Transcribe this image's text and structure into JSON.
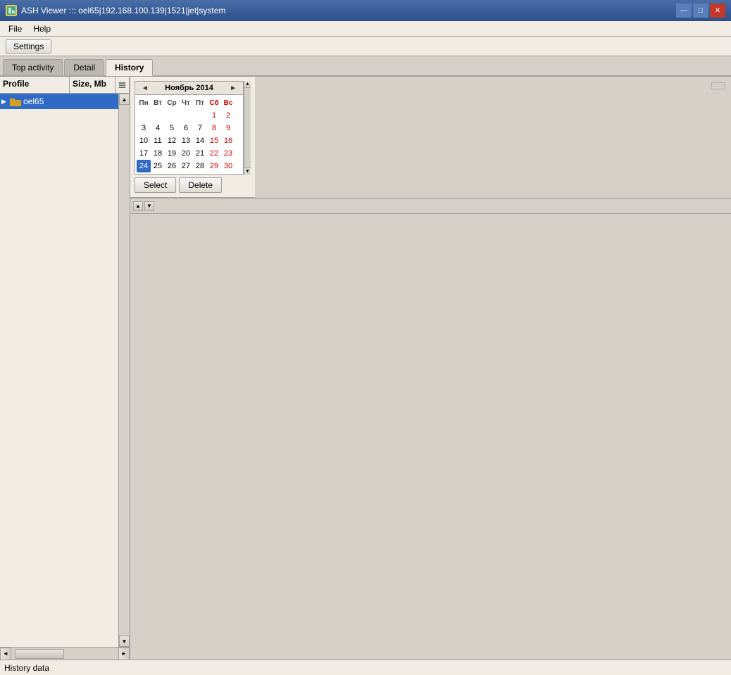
{
  "window": {
    "title": "ASH Viewer ::: oel65|192.168.100.139|1521|jet|system",
    "icon": "⬛"
  },
  "menu": {
    "file": "File",
    "help": "Help"
  },
  "toolbar": {
    "settings": "Settings"
  },
  "tabs": [
    {
      "id": "top-activity",
      "label": "Top activity"
    },
    {
      "id": "detail",
      "label": "Detail"
    },
    {
      "id": "history",
      "label": "History"
    }
  ],
  "active_tab": "history",
  "left_panel": {
    "col_profile": "Profile",
    "col_size": "Size, Mb",
    "tree_item": "oel65"
  },
  "calendar": {
    "month_year": "Ноябрь 2014",
    "days_header": [
      "Пн",
      "Вт",
      "Ср",
      "Чт",
      "Пт",
      "Сб",
      "Вс"
    ],
    "weeks": [
      [
        null,
        null,
        null,
        null,
        null,
        1,
        2
      ],
      [
        3,
        4,
        5,
        6,
        7,
        8,
        9
      ],
      [
        10,
        11,
        12,
        13,
        14,
        15,
        16
      ],
      [
        17,
        18,
        19,
        20,
        21,
        22,
        23
      ],
      [
        24,
        25,
        26,
        27,
        28,
        29,
        30
      ]
    ],
    "weekends_cols": [
      5,
      6
    ],
    "selected_day": 24,
    "select_btn": "Select",
    "delete_btn": "Delete"
  },
  "status_bar": {
    "text": "History data"
  }
}
